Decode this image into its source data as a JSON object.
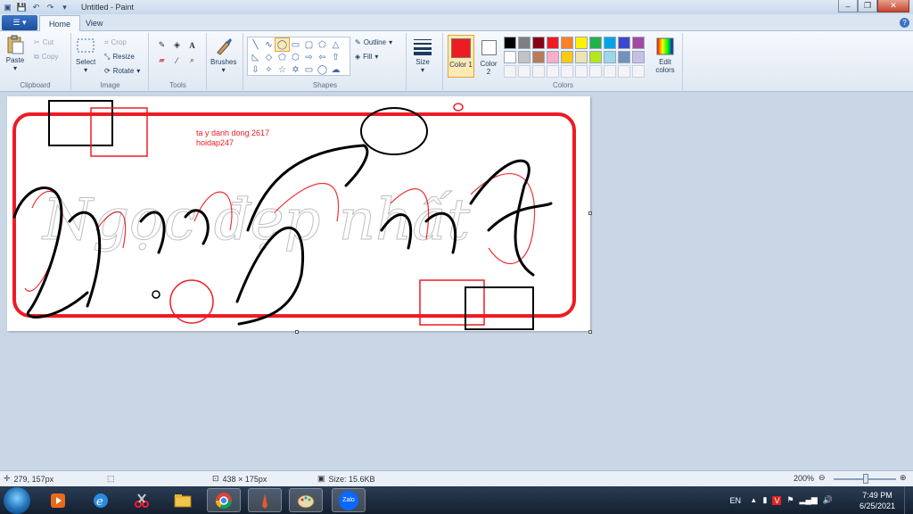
{
  "window": {
    "title": "Untitled - Paint"
  },
  "tabs": [
    {
      "label": "Home",
      "active": true
    },
    {
      "label": "View",
      "active": false
    }
  ],
  "ribbon": {
    "clipboard": {
      "label": "Clipboard",
      "paste": "Paste",
      "cut": "Cut",
      "copy": "Copy"
    },
    "image": {
      "label": "Image",
      "select": "Select",
      "crop": "Crop",
      "resize": "Resize",
      "rotate": "Rotate"
    },
    "tools": {
      "label": "Tools"
    },
    "brushes": {
      "label": "Brushes"
    },
    "shapes": {
      "label": "Shapes",
      "outline": "Outline",
      "fill": "Fill"
    },
    "size": {
      "label": "Size"
    },
    "colors": {
      "label": "Colors",
      "color1_label": "Color 1",
      "color1": "#ed1c24",
      "color2_label": "Color 2",
      "color2": "#ffffff",
      "edit_label": "Edit colors",
      "palette": [
        "#000000",
        "#7f7f7f",
        "#880015",
        "#ed1c24",
        "#ff7f27",
        "#fff200",
        "#22b14c",
        "#00a2e8",
        "#3f48cc",
        "#a349a4",
        "#ffffff",
        "#c3c3c3",
        "#b97a57",
        "#ffaec9",
        "#ffc90e",
        "#efe4b0",
        "#b5e61d",
        "#99d9ea",
        "#7092be",
        "#c8bfe7"
      ]
    }
  },
  "canvas": {
    "caption_line1": "ta y danh dong 2617",
    "caption_line2": "hoidap247",
    "script_text": "Ngọc đẹp nhất"
  },
  "status": {
    "cursor_pos": "279, 157px",
    "image_size": "438 × 175px",
    "file_size": "Size: 15.6KB",
    "zoom": "200%"
  },
  "taskbar": {
    "language": "EN",
    "time": "7:49 PM",
    "date": "6/25/2021",
    "zalo_label": "Zalo"
  }
}
